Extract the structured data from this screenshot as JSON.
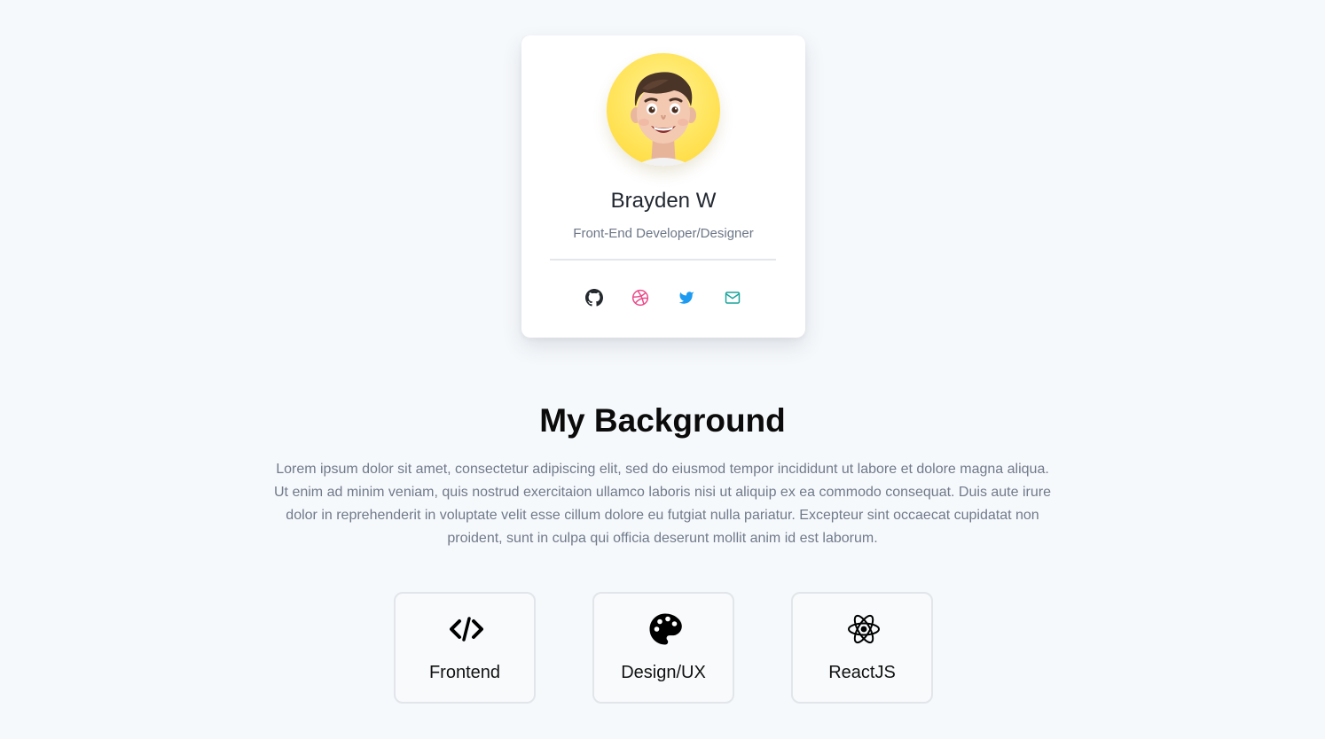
{
  "profile": {
    "name": "Brayden W",
    "role": "Front-End Developer/Designer",
    "avatar_icon": "memoji-avatar",
    "socials": [
      {
        "icon": "github-icon",
        "color": "#24292e"
      },
      {
        "icon": "dribbble-icon",
        "color": "#ea4c89"
      },
      {
        "icon": "twitter-icon",
        "color": "#1d9bf0"
      },
      {
        "icon": "mail-icon",
        "color": "#1aa39a"
      }
    ]
  },
  "background": {
    "title": "My Background",
    "text": "Lorem ipsum dolor sit amet, consectetur adipiscing elit, sed do eiusmod tempor incididunt ut labore et dolore magna aliqua. Ut enim ad minim veniam, quis nostrud exercitaion ullamco laboris nisi ut aliquip ex ea commodo consequat. Duis aute irure dolor in reprehenderit in voluptate velit esse cillum dolore eu futgiat nulla pariatur. Excepteur sint occaecat cupidatat non proident, sunt in culpa qui officia deserunt mollit anim id est laborum."
  },
  "skills": [
    {
      "label": "Frontend",
      "icon": "code-icon"
    },
    {
      "label": "Design/UX",
      "icon": "palette-icon"
    },
    {
      "label": "ReactJS",
      "icon": "react-icon"
    }
  ],
  "colors": {
    "page_background": "#f6f9fc",
    "avatar_background": "#ffe766",
    "heading": "#0b0b0b",
    "muted_text": "#707a8a"
  }
}
